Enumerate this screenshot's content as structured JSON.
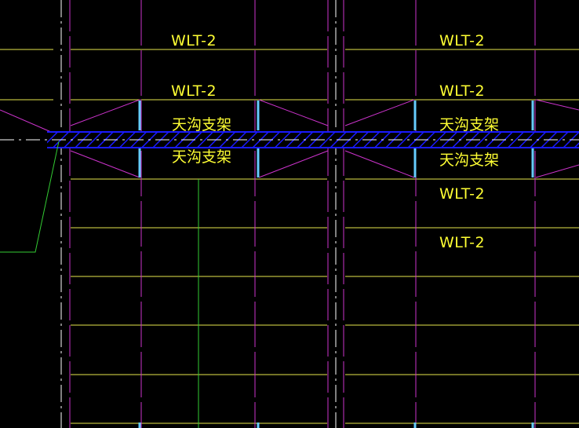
{
  "colors": {
    "background": "#000000",
    "yellow": "#ffff33",
    "magenta": "#cc33cc",
    "white": "#ffffff",
    "green": "#33cc33",
    "blue": "#1a1aff",
    "cyan": "#66ccff"
  },
  "labels": {
    "left_top_1": "WLT-2",
    "left_top_2": "WLT-2",
    "left_cn_1": "天沟支架",
    "left_cn_2": "天沟支架",
    "right_top_1": "WLT-2",
    "right_top_2": "WLT-2",
    "right_cn_1": "天沟支架",
    "right_cn_2": "天沟支架",
    "right_bottom_1": "WLT-2",
    "right_bottom_2": "WLT-2"
  }
}
